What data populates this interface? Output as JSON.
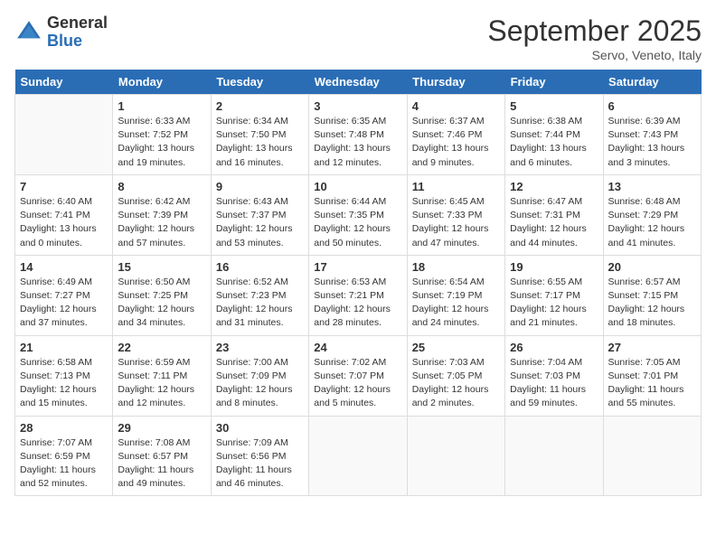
{
  "header": {
    "logo_general": "General",
    "logo_blue": "Blue",
    "month_title": "September 2025",
    "subtitle": "Servo, Veneto, Italy"
  },
  "days_of_week": [
    "Sunday",
    "Monday",
    "Tuesday",
    "Wednesday",
    "Thursday",
    "Friday",
    "Saturday"
  ],
  "weeks": [
    [
      {
        "day": "",
        "info": ""
      },
      {
        "day": "1",
        "info": "Sunrise: 6:33 AM\nSunset: 7:52 PM\nDaylight: 13 hours\nand 19 minutes."
      },
      {
        "day": "2",
        "info": "Sunrise: 6:34 AM\nSunset: 7:50 PM\nDaylight: 13 hours\nand 16 minutes."
      },
      {
        "day": "3",
        "info": "Sunrise: 6:35 AM\nSunset: 7:48 PM\nDaylight: 13 hours\nand 12 minutes."
      },
      {
        "day": "4",
        "info": "Sunrise: 6:37 AM\nSunset: 7:46 PM\nDaylight: 13 hours\nand 9 minutes."
      },
      {
        "day": "5",
        "info": "Sunrise: 6:38 AM\nSunset: 7:44 PM\nDaylight: 13 hours\nand 6 minutes."
      },
      {
        "day": "6",
        "info": "Sunrise: 6:39 AM\nSunset: 7:43 PM\nDaylight: 13 hours\nand 3 minutes."
      }
    ],
    [
      {
        "day": "7",
        "info": "Sunrise: 6:40 AM\nSunset: 7:41 PM\nDaylight: 13 hours\nand 0 minutes."
      },
      {
        "day": "8",
        "info": "Sunrise: 6:42 AM\nSunset: 7:39 PM\nDaylight: 12 hours\nand 57 minutes."
      },
      {
        "day": "9",
        "info": "Sunrise: 6:43 AM\nSunset: 7:37 PM\nDaylight: 12 hours\nand 53 minutes."
      },
      {
        "day": "10",
        "info": "Sunrise: 6:44 AM\nSunset: 7:35 PM\nDaylight: 12 hours\nand 50 minutes."
      },
      {
        "day": "11",
        "info": "Sunrise: 6:45 AM\nSunset: 7:33 PM\nDaylight: 12 hours\nand 47 minutes."
      },
      {
        "day": "12",
        "info": "Sunrise: 6:47 AM\nSunset: 7:31 PM\nDaylight: 12 hours\nand 44 minutes."
      },
      {
        "day": "13",
        "info": "Sunrise: 6:48 AM\nSunset: 7:29 PM\nDaylight: 12 hours\nand 41 minutes."
      }
    ],
    [
      {
        "day": "14",
        "info": "Sunrise: 6:49 AM\nSunset: 7:27 PM\nDaylight: 12 hours\nand 37 minutes."
      },
      {
        "day": "15",
        "info": "Sunrise: 6:50 AM\nSunset: 7:25 PM\nDaylight: 12 hours\nand 34 minutes."
      },
      {
        "day": "16",
        "info": "Sunrise: 6:52 AM\nSunset: 7:23 PM\nDaylight: 12 hours\nand 31 minutes."
      },
      {
        "day": "17",
        "info": "Sunrise: 6:53 AM\nSunset: 7:21 PM\nDaylight: 12 hours\nand 28 minutes."
      },
      {
        "day": "18",
        "info": "Sunrise: 6:54 AM\nSunset: 7:19 PM\nDaylight: 12 hours\nand 24 minutes."
      },
      {
        "day": "19",
        "info": "Sunrise: 6:55 AM\nSunset: 7:17 PM\nDaylight: 12 hours\nand 21 minutes."
      },
      {
        "day": "20",
        "info": "Sunrise: 6:57 AM\nSunset: 7:15 PM\nDaylight: 12 hours\nand 18 minutes."
      }
    ],
    [
      {
        "day": "21",
        "info": "Sunrise: 6:58 AM\nSunset: 7:13 PM\nDaylight: 12 hours\nand 15 minutes."
      },
      {
        "day": "22",
        "info": "Sunrise: 6:59 AM\nSunset: 7:11 PM\nDaylight: 12 hours\nand 12 minutes."
      },
      {
        "day": "23",
        "info": "Sunrise: 7:00 AM\nSunset: 7:09 PM\nDaylight: 12 hours\nand 8 minutes."
      },
      {
        "day": "24",
        "info": "Sunrise: 7:02 AM\nSunset: 7:07 PM\nDaylight: 12 hours\nand 5 minutes."
      },
      {
        "day": "25",
        "info": "Sunrise: 7:03 AM\nSunset: 7:05 PM\nDaylight: 12 hours\nand 2 minutes."
      },
      {
        "day": "26",
        "info": "Sunrise: 7:04 AM\nSunset: 7:03 PM\nDaylight: 11 hours\nand 59 minutes."
      },
      {
        "day": "27",
        "info": "Sunrise: 7:05 AM\nSunset: 7:01 PM\nDaylight: 11 hours\nand 55 minutes."
      }
    ],
    [
      {
        "day": "28",
        "info": "Sunrise: 7:07 AM\nSunset: 6:59 PM\nDaylight: 11 hours\nand 52 minutes."
      },
      {
        "day": "29",
        "info": "Sunrise: 7:08 AM\nSunset: 6:57 PM\nDaylight: 11 hours\nand 49 minutes."
      },
      {
        "day": "30",
        "info": "Sunrise: 7:09 AM\nSunset: 6:56 PM\nDaylight: 11 hours\nand 46 minutes."
      },
      {
        "day": "",
        "info": ""
      },
      {
        "day": "",
        "info": ""
      },
      {
        "day": "",
        "info": ""
      },
      {
        "day": "",
        "info": ""
      }
    ]
  ]
}
